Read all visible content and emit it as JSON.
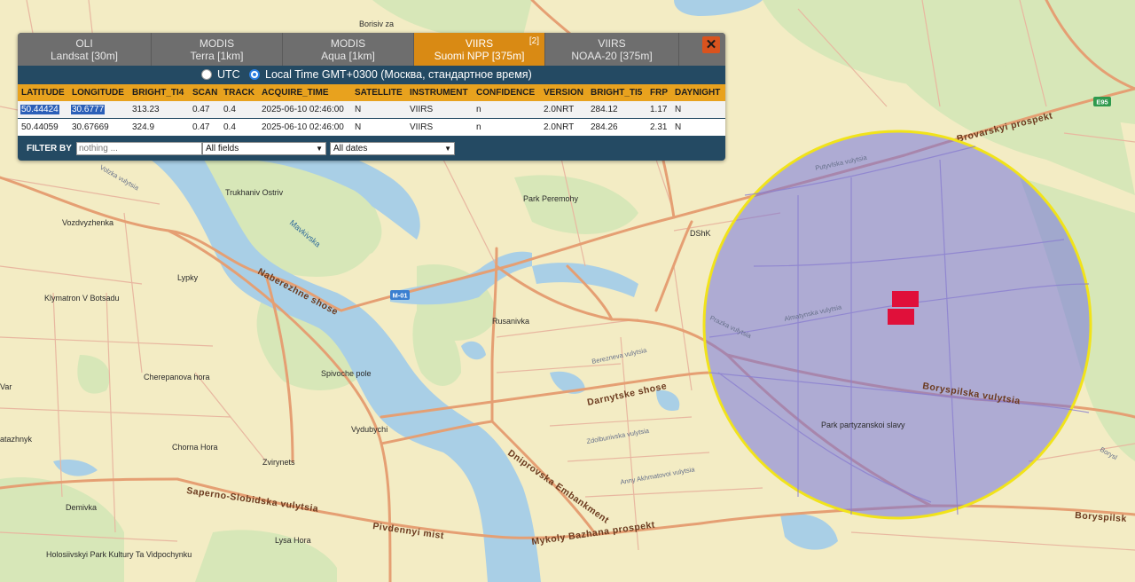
{
  "tabs": [
    {
      "title": "OLI",
      "subtitle": "Landsat [30m]",
      "active": false
    },
    {
      "title": "MODIS",
      "subtitle": "Terra [1km]",
      "active": false
    },
    {
      "title": "MODIS",
      "subtitle": "Aqua [1km]",
      "active": false
    },
    {
      "title": "VIIRS",
      "subtitle": "Suomi NPP [375m]",
      "active": true,
      "count": "[2]"
    },
    {
      "title": "VIIRS",
      "subtitle": "NOAA-20 [375m]",
      "active": false
    }
  ],
  "close_label": "✕",
  "timezone": {
    "utc_label": "UTC",
    "local_label": "Local Time GMT+0300 (Москва, стандартное время)",
    "selected": "local"
  },
  "table": {
    "headers": [
      "LATITUDE",
      "LONGITUDE",
      "BRIGHT_TI4",
      "SCAN",
      "TRACK",
      "ACQUIRE_TIME",
      "SATELLITE",
      "INSTRUMENT",
      "CONFIDENCE",
      "VERSION",
      "BRIGHT_TI5",
      "FRP",
      "DAYNIGHT"
    ],
    "rows": [
      [
        "50.44424",
        "30.6777",
        "313.23",
        "0.47",
        "0.4",
        "2025-06-10 02:46:00",
        "N",
        "VIIRS",
        "n",
        "2.0NRT",
        "284.12",
        "1.17",
        "N"
      ],
      [
        "50.44059",
        "30.67669",
        "324.9",
        "0.47",
        "0.4",
        "2025-06-10 02:46:00",
        "N",
        "VIIRS",
        "n",
        "2.0NRT",
        "284.26",
        "2.31",
        "N"
      ]
    ]
  },
  "filter": {
    "label": "FILTER BY",
    "placeholder": "nothing ...",
    "fields_value": "All fields",
    "dates_value": "All dates"
  },
  "map": {
    "places": [
      "Borisiv za",
      "Trukhaniv Ostriv",
      "Vozdvyzhenka",
      "Lypky",
      "Klymatron V Botsadu",
      "Cherepanova hora",
      "Chorna Hora",
      "Zvirynets",
      "Demivka",
      "Lysa Hora",
      "Holosiivskyi Park Kultury Ta Vidpochynku",
      "Rusanivka",
      "Vydubychi",
      "Spivoche pole",
      "Park Peremohy",
      "DShK",
      "Park partyzanskoi slavy",
      "Var",
      "atazhnyk"
    ],
    "water": [
      "Mavkivska"
    ],
    "roads": [
      "Naberezhne shose",
      "Darnytske shose",
      "Dniprovska Embankment",
      "Saperno-Slobidska vulytsia",
      "Pivdennyi mist",
      "Mykoly Bazhana prospekt",
      "Brovarskyi prospekt",
      "Boryspilska vulytsia",
      "Boryspilsk"
    ],
    "streets": [
      "Putyvlska vulytsia",
      "Almatynska vulytsia",
      "Prazka vulytsia",
      "Berezneva vulytsia",
      "Zdolbunivska vulytsia",
      "Anny Akhmatovoi vulytsia",
      "Volzka vulytsia",
      "Borysl"
    ],
    "shields": [
      "M-01",
      "E95"
    ],
    "search_radius_color": "#6f6fe0",
    "fire_pixel_color": "#e0103a"
  }
}
